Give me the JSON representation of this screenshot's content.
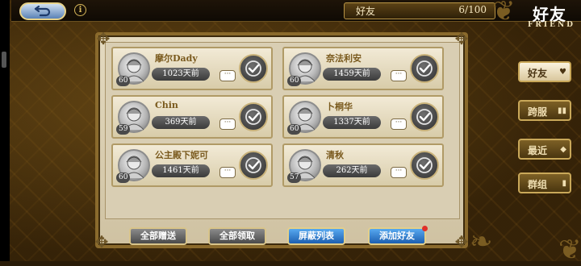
{
  "header": {
    "back_icon": "back-arrow-icon",
    "info_icon_glyph": "i",
    "friend_count_label": "好友",
    "friend_count_value": "6/100",
    "title_zh": "好友",
    "title_en": "FRIEND"
  },
  "friends": [
    {
      "name": "摩尔Dady",
      "level": "60",
      "last_seen": "1023天前"
    },
    {
      "name": "奈法利安",
      "level": "60",
      "last_seen": "1459天前"
    },
    {
      "name": "Chin",
      "level": "59",
      "last_seen": "369天前"
    },
    {
      "name": "卜桐华",
      "level": "60",
      "last_seen": "1337天前"
    },
    {
      "name": "公主殿下妮可",
      "level": "60",
      "last_seen": "1461天前"
    },
    {
      "name": "清秋",
      "level": "57",
      "last_seen": "262天前"
    }
  ],
  "chat_glyph": "···",
  "buttons": {
    "gift_all": "全部赠送",
    "claim_all": "全部领取",
    "block_list": "屏蔽列表",
    "add_friend": "添加好友"
  },
  "side_tabs": [
    {
      "label": "好友",
      "icon": "♥",
      "active": true
    },
    {
      "label": "跨服",
      "icon": "▮▮"
    },
    {
      "label": "最近",
      "icon": "◆"
    },
    {
      "label": "群组",
      "icon": "▮"
    }
  ],
  "colors": {
    "panel_bg": "#e4dac0",
    "gold_border": "#c9a859",
    "blue_button": "#1d5fb0",
    "grey_button": "#4a4a4a"
  }
}
